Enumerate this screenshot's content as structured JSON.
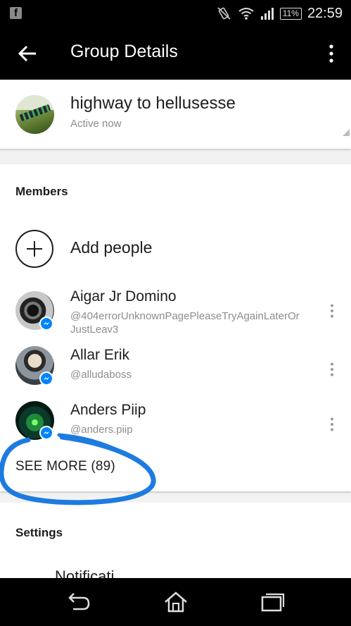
{
  "status_bar": {
    "app_icon": "f",
    "battery": "11%",
    "time": "22:59",
    "icons": [
      "silent-vibrate-icon",
      "wifi-icon",
      "signal-icon"
    ]
  },
  "app_bar": {
    "title": "Group Details",
    "icons": [
      "back-arrow-icon",
      "overflow-menu-icon"
    ]
  },
  "group": {
    "name": "highway to hellusesse",
    "status": "Active now"
  },
  "members": {
    "title": "Members",
    "add_label": "Add people",
    "items": [
      {
        "name": "Aigar Jr Domino",
        "handle": "@404errorUnknownPagePleaseTryAgainLaterOrJustLeav3"
      },
      {
        "name": "Allar Erik",
        "handle": "@alludaboss"
      },
      {
        "name": "Anders Piip",
        "handle": "@anders.piip"
      }
    ],
    "see_more": "SEE MORE (89)"
  },
  "settings": {
    "title": "Settings",
    "first_item_partial": "Notificati"
  },
  "colors": {
    "messenger_badge": "#0084ff",
    "annotation_stroke": "#1d7be0"
  },
  "nav_bar": {
    "icons": [
      "back-nav-icon",
      "home-icon",
      "recents-icon"
    ]
  }
}
